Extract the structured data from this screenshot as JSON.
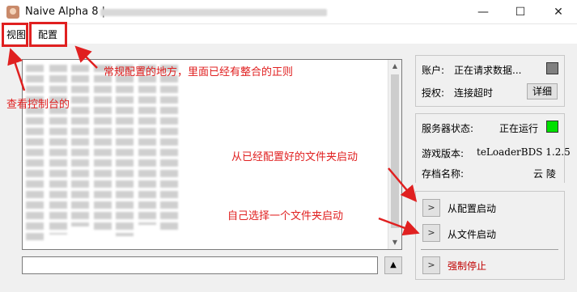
{
  "window": {
    "title": "Naive Alpha 8 |",
    "minimize_icon": "minimize-icon",
    "maximize_icon": "maximize-icon",
    "close_icon": "close-icon"
  },
  "menu": {
    "items": [
      {
        "label": "视图"
      },
      {
        "label": "配置"
      }
    ]
  },
  "annotations": {
    "config_note": "常规配置的地方，里面已经有整合的正则",
    "console_note": "查看控制台的",
    "start_config_note": "从已经配置好的文件夹启动",
    "start_folder_note": "自己选择一个文件夹启动",
    "color": "#e02020"
  },
  "console": {
    "command_value": "",
    "scroll_up_icon": "up-arrow-icon"
  },
  "account": {
    "account_label": "账户:",
    "account_value": "正在请求数据...",
    "auth_label": "授权:",
    "auth_value": "连接超时",
    "detail_button": "详细",
    "status_color": "#808080"
  },
  "server": {
    "status_label": "服务器状态:",
    "status_value": "正在运行",
    "status_color": "#00e000",
    "version_label": "游戏版本:",
    "version_value": "teLoaderBDS 1.2.5",
    "save_label": "存档名称:",
    "save_value": "云 陵"
  },
  "actions": {
    "start_from_config": "从配置启动",
    "start_from_file": "从文件启动",
    "force_stop": "强制停止",
    "force_stop_color": "#c00000",
    "arrow_glyph": ">"
  }
}
